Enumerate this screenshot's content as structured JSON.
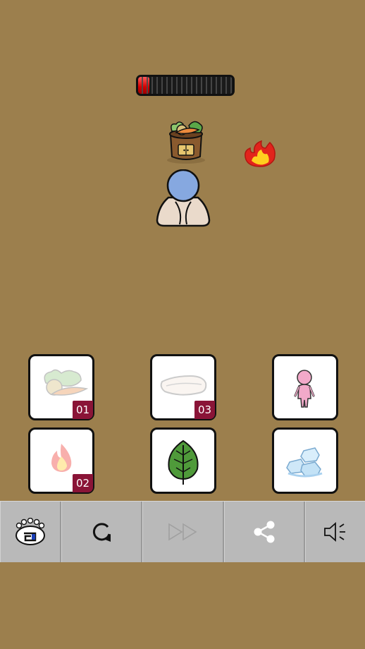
{
  "meter": {
    "level": 0.12
  },
  "items": [
    {
      "name": "vegetables",
      "count": "01",
      "faded": true
    },
    {
      "name": "cloth",
      "count": "03",
      "faded": true
    },
    {
      "name": "doll",
      "count": "",
      "faded": false
    },
    {
      "name": "fire",
      "count": "02",
      "faded": true
    },
    {
      "name": "leaf",
      "count": "",
      "faded": false
    },
    {
      "name": "ice",
      "count": "",
      "faded": false
    }
  ],
  "toolbar": {
    "buttons": [
      {
        "icon": "logo-icon"
      },
      {
        "icon": "restart-icon"
      },
      {
        "icon": "fast-forward-icon",
        "disabled": true
      },
      {
        "icon": "share-icon"
      },
      {
        "icon": "sound-icon"
      }
    ]
  },
  "colors": {
    "background": "#9c7f4d",
    "toolbar": "#b9b9b9",
    "badge": "#8a1437",
    "meter_fill": "#d40000",
    "character_head": "#86a8e0"
  }
}
